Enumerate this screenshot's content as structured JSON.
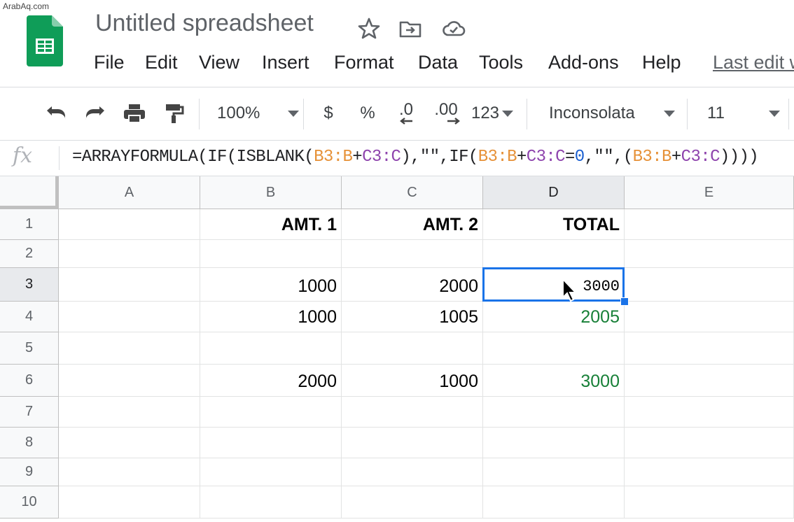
{
  "watermark": "ArabAq.com",
  "document": {
    "title": "Untitled spreadsheet"
  },
  "icons": {
    "title": [
      "star-icon",
      "move-to-folder-icon",
      "cloud-saved-icon"
    ]
  },
  "menu": {
    "items": [
      "File",
      "Edit",
      "View",
      "Insert",
      "Format",
      "Data",
      "Tools",
      "Add-ons",
      "Help"
    ],
    "last_edit": "Last edit w"
  },
  "toolbar": {
    "zoom": "100%",
    "currency": "$",
    "percent": "%",
    "decrease_decimal": ".0",
    "increase_decimal": ".00",
    "more_formats": "123",
    "font": "Inconsolata",
    "font_size": "11"
  },
  "formula_bar": {
    "fx_label": "fx",
    "tokens": [
      {
        "text": "=ARRAYFORMULA(IF(ISBLANK(",
        "color": "#202124"
      },
      {
        "text": "B3:B",
        "color": "#e69138"
      },
      {
        "text": "+",
        "color": "#202124"
      },
      {
        "text": "C3:C",
        "color": "#8e44ad"
      },
      {
        "text": "),\"\",IF(",
        "color": "#202124"
      },
      {
        "text": "B3:B",
        "color": "#e69138"
      },
      {
        "text": "+",
        "color": "#202124"
      },
      {
        "text": "C3:C",
        "color": "#8e44ad"
      },
      {
        "text": "=",
        "color": "#202124"
      },
      {
        "text": "0",
        "color": "#1a5fd0"
      },
      {
        "text": ",\"\",(",
        "color": "#202124"
      },
      {
        "text": "B3:B",
        "color": "#e69138"
      },
      {
        "text": "+",
        "color": "#202124"
      },
      {
        "text": "C3:C",
        "color": "#8e44ad"
      },
      {
        "text": "))))",
        "color": "#202124"
      }
    ]
  },
  "sheet": {
    "columns": [
      "A",
      "B",
      "C",
      "D",
      "E"
    ],
    "selected_column": "D",
    "selected_row": "3",
    "rows": [
      {
        "n": "1",
        "cells": [
          "",
          "AMT. 1",
          "AMT. 2",
          "TOTAL",
          ""
        ]
      },
      {
        "n": "2",
        "cells": [
          "",
          "",
          "",
          "",
          ""
        ]
      },
      {
        "n": "3",
        "cells": [
          "",
          "1000",
          "2000",
          "3000",
          ""
        ]
      },
      {
        "n": "4",
        "cells": [
          "",
          "1000",
          "1005",
          "2005",
          ""
        ]
      },
      {
        "n": "5",
        "cells": [
          "",
          "",
          "",
          "",
          ""
        ]
      },
      {
        "n": "6",
        "cells": [
          "",
          "2000",
          "1000",
          "3000",
          ""
        ]
      },
      {
        "n": "7",
        "cells": [
          "",
          "",
          "",
          "",
          ""
        ]
      },
      {
        "n": "8",
        "cells": [
          "",
          "",
          "",
          "",
          ""
        ]
      },
      {
        "n": "9",
        "cells": [
          "",
          "",
          "",
          "",
          ""
        ]
      },
      {
        "n": "10",
        "cells": [
          "",
          "",
          "",
          "",
          ""
        ]
      }
    ],
    "colors": {
      "selection": "#1a73e8",
      "formula_result": "#188038"
    }
  }
}
